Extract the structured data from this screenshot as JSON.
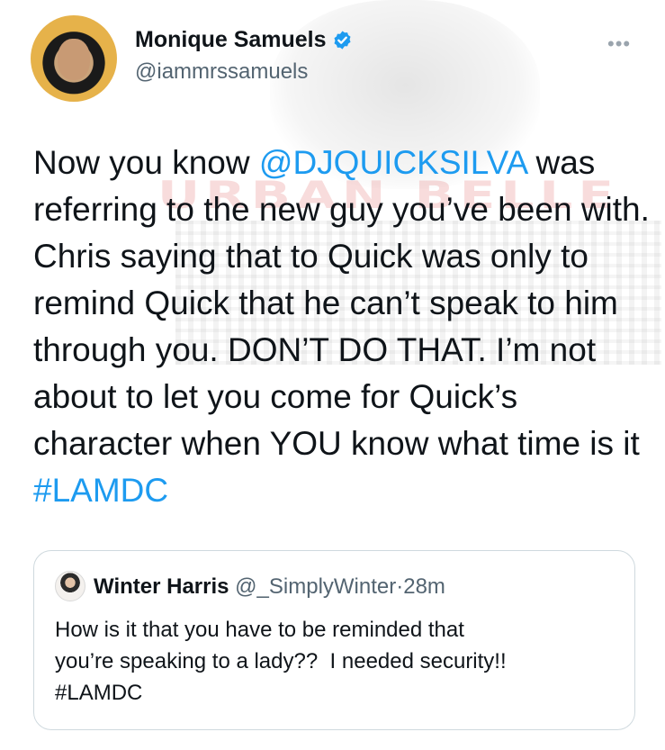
{
  "watermark": {
    "text": "URBAN BELLE"
  },
  "author": {
    "display_name": "Monique Samuels",
    "handle": "@iammrssamuels",
    "verified_icon": "verified-badge-icon",
    "more_icon": "more-icon"
  },
  "tweet": {
    "part1": "Now you know ",
    "mention": "@DJQUICKSILVA",
    "part2": " was referring to the new guy you’ve been with. Chris saying that to Quick was only to remind Quick that he can’t speak to him through you. DON’T DO THAT. I’m not about to let you come for Quick’s character when YOU know what time is it ",
    "hashtag": "#LAMDC"
  },
  "quoted": {
    "display_name": "Winter Harris",
    "handle": "@_SimplyWinter",
    "separator": "·",
    "time": "28m",
    "text_line1": "How is it that you have to be reminded that",
    "text_line2": "you’re speaking to a lady??  I needed security!!",
    "hashtag": "#LAMDC"
  },
  "colors": {
    "accent": "#1d9bf0",
    "text": "#0f1419",
    "muted": "#536471",
    "border": "#cfd9de"
  }
}
